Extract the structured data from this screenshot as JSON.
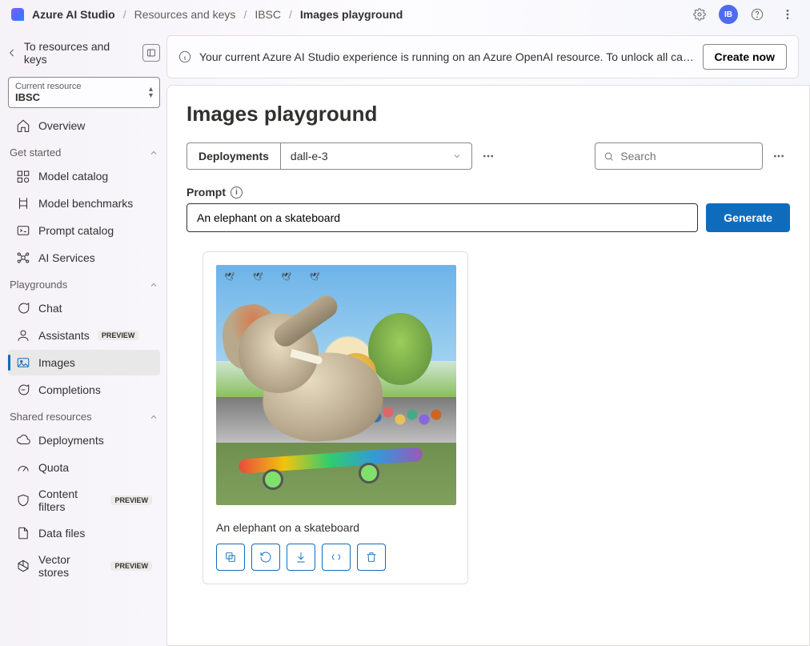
{
  "header": {
    "brand": "Azure AI Studio",
    "breadcrumbs": [
      "Resources and keys",
      "IBSC",
      "Images playground"
    ],
    "avatar_initials": "IB"
  },
  "sidebar": {
    "back_link": "To resources and keys",
    "resource_label": "Current resource",
    "resource_value": "IBSC",
    "overview": "Overview",
    "sections": {
      "get_started": {
        "title": "Get started",
        "items": [
          {
            "label": "Model catalog"
          },
          {
            "label": "Model benchmarks"
          },
          {
            "label": "Prompt catalog"
          },
          {
            "label": "AI Services"
          }
        ]
      },
      "playgrounds": {
        "title": "Playgrounds",
        "items": [
          {
            "label": "Chat"
          },
          {
            "label": "Assistants",
            "badge": "PREVIEW"
          },
          {
            "label": "Images",
            "active": true
          },
          {
            "label": "Completions"
          }
        ]
      },
      "shared": {
        "title": "Shared resources",
        "items": [
          {
            "label": "Deployments"
          },
          {
            "label": "Quota"
          },
          {
            "label": "Content filters",
            "badge": "PREVIEW"
          },
          {
            "label": "Data files"
          },
          {
            "label": "Vector stores",
            "badge": "PREVIEW"
          }
        ]
      }
    }
  },
  "notice": {
    "text": "Your current Azure AI Studio experience is running on an Azure OpenAI resource. To unlock all capabilities, create a...",
    "button": "Create now"
  },
  "page": {
    "title": "Images playground",
    "deployments_label": "Deployments",
    "selected_deployment": "dall-e-3",
    "search_placeholder": "Search",
    "prompt_label": "Prompt",
    "prompt_value": "An elephant on a skateboard",
    "generate_button": "Generate",
    "result_caption": "An elephant on a skateboard"
  }
}
